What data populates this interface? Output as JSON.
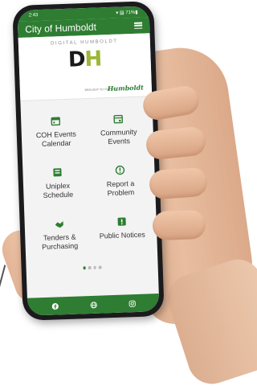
{
  "status": {
    "time": "2:43",
    "indicators": "▾ ▤ 71%▮"
  },
  "app": {
    "title": "City of Humboldt"
  },
  "banner": {
    "tagline": "DIGITAL HUMBOLDT",
    "logo_d": "D",
    "logo_h": "H",
    "brand": "Humboldt",
    "brand_prefix": "BROUGHT TO YOU BY"
  },
  "tiles": [
    {
      "label1": "COH Events",
      "label2": "Calendar",
      "icon": "calendar-icon"
    },
    {
      "label1": "Community",
      "label2": "Events",
      "icon": "community-calendar-icon"
    },
    {
      "label1": "Uniplex",
      "label2": "Schedule",
      "icon": "schedule-icon"
    },
    {
      "label1": "Report a",
      "label2": "Problem",
      "icon": "alert-icon"
    },
    {
      "label1": "Tenders &",
      "label2": "Purchasing",
      "icon": "handshake-icon"
    },
    {
      "label1": "Public Notices",
      "label2": "",
      "icon": "notice-icon"
    }
  ],
  "pager": {
    "pages": 4,
    "active": 1
  },
  "bottom_bar": [
    "facebook-icon",
    "globe-icon",
    "instagram-icon"
  ],
  "colors": {
    "brand_green": "#2e7d32",
    "logo_accent": "#9cb636"
  }
}
